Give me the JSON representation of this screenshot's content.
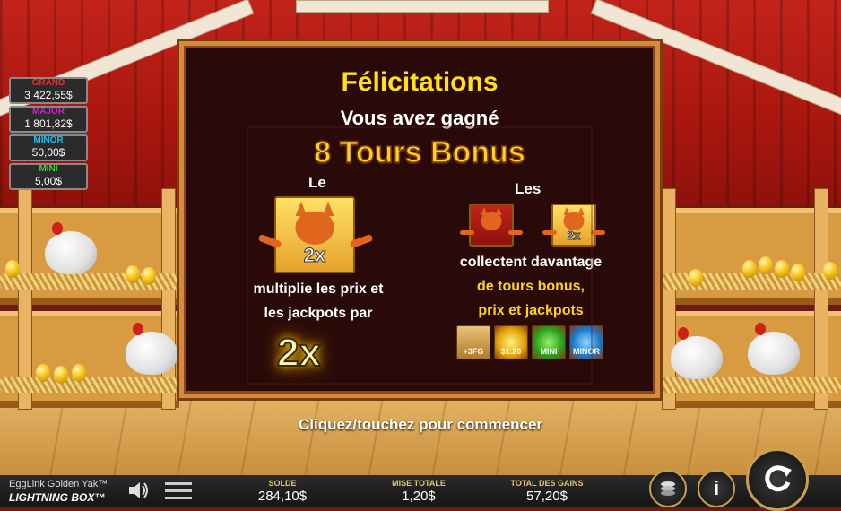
{
  "jackpots": [
    {
      "name": "GRAND",
      "value": "3 422,55$",
      "color": "#e3302a"
    },
    {
      "name": "MAJOR",
      "value": "1 801,82$",
      "color": "#d01fcf"
    },
    {
      "name": "MINOR",
      "value": "50,00$",
      "color": "#1ec1f1"
    },
    {
      "name": "MINI",
      "value": "5,00$",
      "color": "#3fd43a"
    }
  ],
  "dialog": {
    "title": "Félicitations",
    "subtitle": "Vous avez gagné",
    "bonus": "8 Tours Bonus",
    "left_article": "Le",
    "left_tile_mult": "2x",
    "left_line1": "multiplie les prix et",
    "left_line2": "les jackpots par",
    "left_big": "2x",
    "right_article": "Les",
    "right_tile_mult": "2x",
    "right_line1": "collectent davantage",
    "right_line2": "de tours bonus,",
    "right_line3": "prix et jackpots",
    "symbols": [
      {
        "label": "+3FG",
        "icon": "free-games-plus-3-icon"
      },
      {
        "label": "$1.20",
        "icon": "gold-egg-cash-icon"
      },
      {
        "label": "MINI",
        "icon": "mini-egg-icon"
      },
      {
        "label": "MINOR",
        "icon": "minor-egg-icon"
      }
    ]
  },
  "start_prompt": "Cliquez/touchez pour commencer",
  "bottom": {
    "game_name": "EggLink Golden Yak™",
    "studio": "LIGHTNING BOX™",
    "solde_label": "SOLDE",
    "solde_value": "284,10$",
    "mise_label": "MISE TOTALE",
    "mise_value": "1,20$",
    "gains_label": "TOTAL DES GAINS",
    "gains_value": "57,20$",
    "info_glyph": "i"
  },
  "colors": {
    "title_yellow": "#ffe01a",
    "bonus_gold": "#ffcf2a",
    "frame": "#d88a3c"
  }
}
